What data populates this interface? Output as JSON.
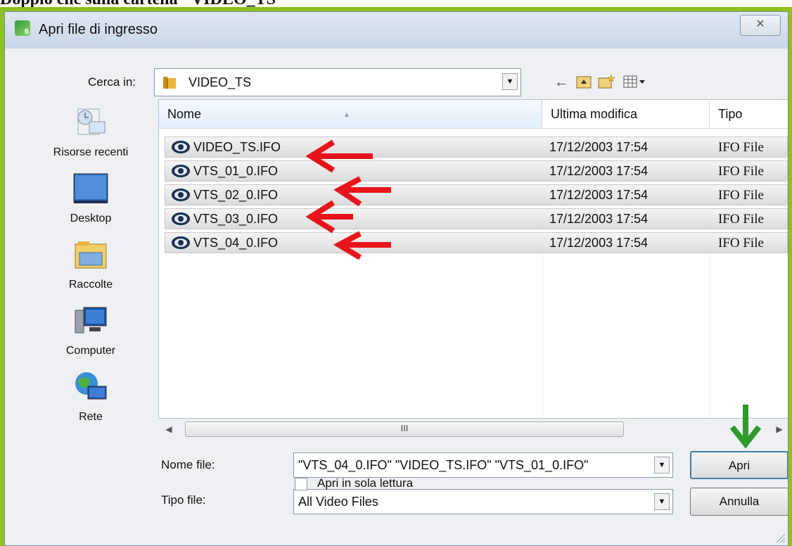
{
  "caption": "Doppio clic sulla cartella \"VIDEO_TS\"",
  "dialog": {
    "title": "Apri file di ingresso",
    "close_glyph": "✕"
  },
  "look_in": {
    "label": "Cerca in:",
    "value": "VIDEO_TS"
  },
  "places": [
    {
      "label": "Risorse recenti",
      "icon": "recent-places-icon"
    },
    {
      "label": "Desktop",
      "icon": "desktop-icon"
    },
    {
      "label": "Raccolte",
      "icon": "libraries-icon"
    },
    {
      "label": "Computer",
      "icon": "computer-icon"
    },
    {
      "label": "Rete",
      "icon": "network-icon"
    }
  ],
  "columns": {
    "name": "Nome",
    "modified": "Ultima modifica",
    "type": "Tipo"
  },
  "files": [
    {
      "name": "VIDEO_TS.IFO",
      "modified": "17/12/2003 17:54",
      "type": "IFO File"
    },
    {
      "name": "VTS_01_0.IFO",
      "modified": "17/12/2003 17:54",
      "type": "IFO File"
    },
    {
      "name": "VTS_02_0.IFO",
      "modified": "17/12/2003 17:54",
      "type": "IFO File"
    },
    {
      "name": "VTS_03_0.IFO",
      "modified": "17/12/2003 17:54",
      "type": "IFO File"
    },
    {
      "name": "VTS_04_0.IFO",
      "modified": "17/12/2003 17:54",
      "type": "IFO File"
    }
  ],
  "scroll_thumb_glyph": "III",
  "file_name": {
    "label": "Nome file:",
    "value": "\"VTS_04_0.IFO\" \"VIDEO_TS.IFO\" \"VTS_01_0.IFO\""
  },
  "file_type": {
    "label": "Tipo file:",
    "value": "All Video Files"
  },
  "buttons": {
    "open": "Apri",
    "cancel": "Annulla"
  },
  "readonly": {
    "label": "Apri in sola lettura",
    "checked": false
  },
  "colors": {
    "frame": "#8dc21f",
    "annotation_red": "#e8141b",
    "annotation_green": "#2e9a2a"
  }
}
